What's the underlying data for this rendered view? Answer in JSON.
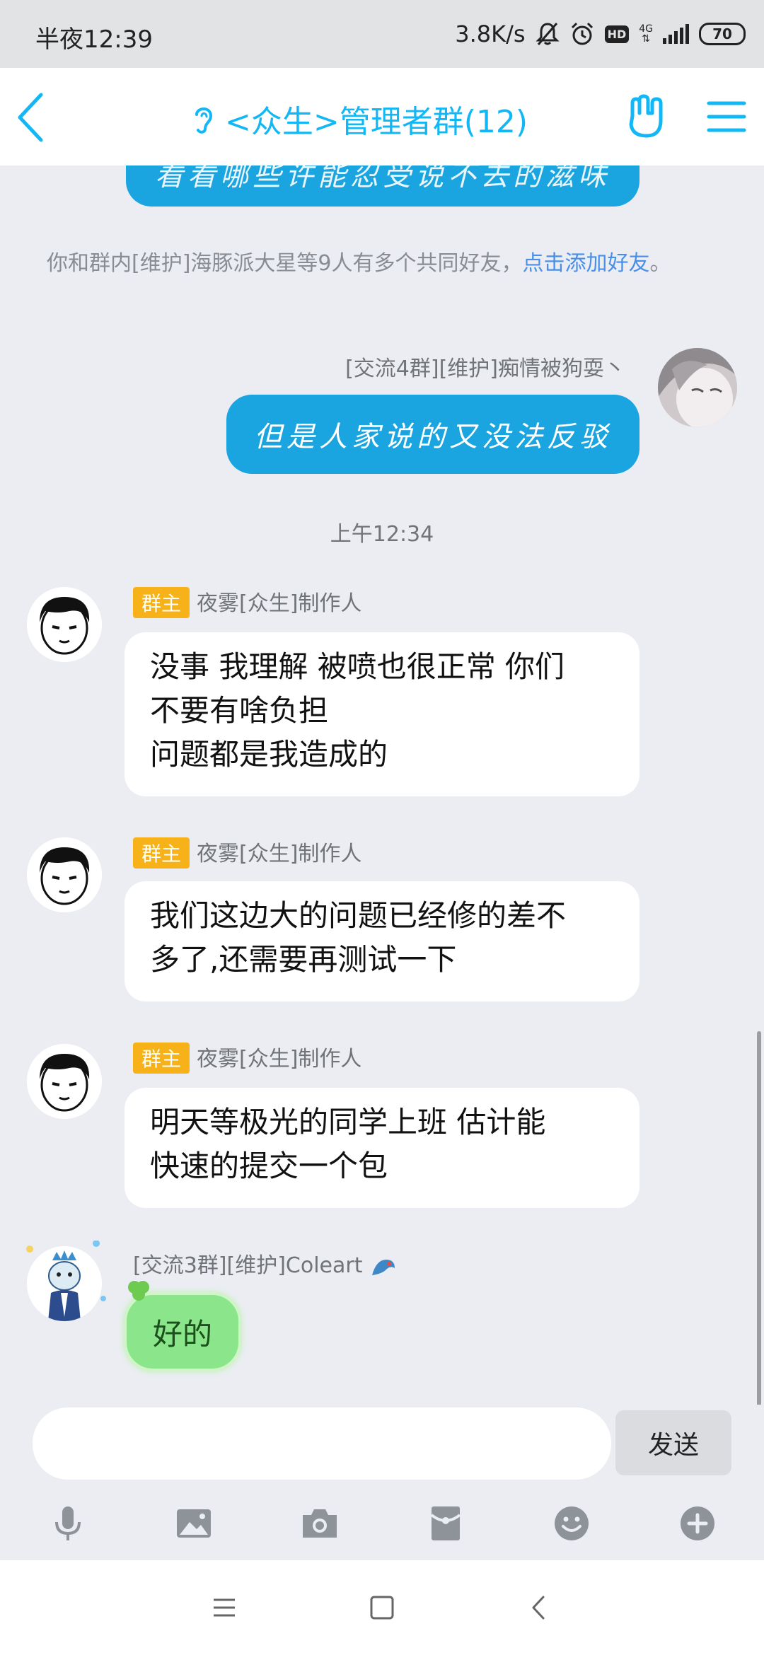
{
  "status_bar": {
    "time": "半夜12:39",
    "net_speed": "3.8K/s",
    "network_type": "4G",
    "hd_label": "HD",
    "battery": "70"
  },
  "header": {
    "title": "<众生>管理者群(12)"
  },
  "chat": {
    "top_bubble_text": "看看哪些许能忍受说不去的滋味",
    "system_tip": {
      "text": "你和群内[维护]海豚派大星等9人有多个共同好友，",
      "link": "点击添加好友",
      "end": "。"
    },
    "outgoing_sender": "[交流4群][维护]痴情被狗耍丶",
    "outgoing_text": "但是人家说的又没法反驳",
    "time_divider": "上午12:34",
    "messages": [
      {
        "badge": "群主",
        "sender": "夜雾[众生]制作人",
        "text": "没事 我理解 被喷也很正常 你们\n不要有啥负担\n问题都是我造成的"
      },
      {
        "badge": "群主",
        "sender": "夜雾[众生]制作人",
        "text": "我们这边大的问题已经修的差不\n多了,还需要再测试一下"
      },
      {
        "badge": "群主",
        "sender": "夜雾[众生]制作人",
        "text": "明天等极光的同学上班 估计能\n快速的提交一个包"
      }
    ],
    "last_sender": "[交流3群][维护]Coleart",
    "last_text": "好的"
  },
  "input": {
    "placeholder": "",
    "send_label": "发送"
  },
  "toolbar": [
    "microphone-icon",
    "image-icon",
    "camera-icon",
    "red-packet-icon",
    "emoji-icon",
    "plus-icon"
  ],
  "colors": {
    "accent": "#12B7F5",
    "bubble_blue": "#1AA5E0",
    "badge": "#F7B21A",
    "background": "#EBEDF3"
  }
}
